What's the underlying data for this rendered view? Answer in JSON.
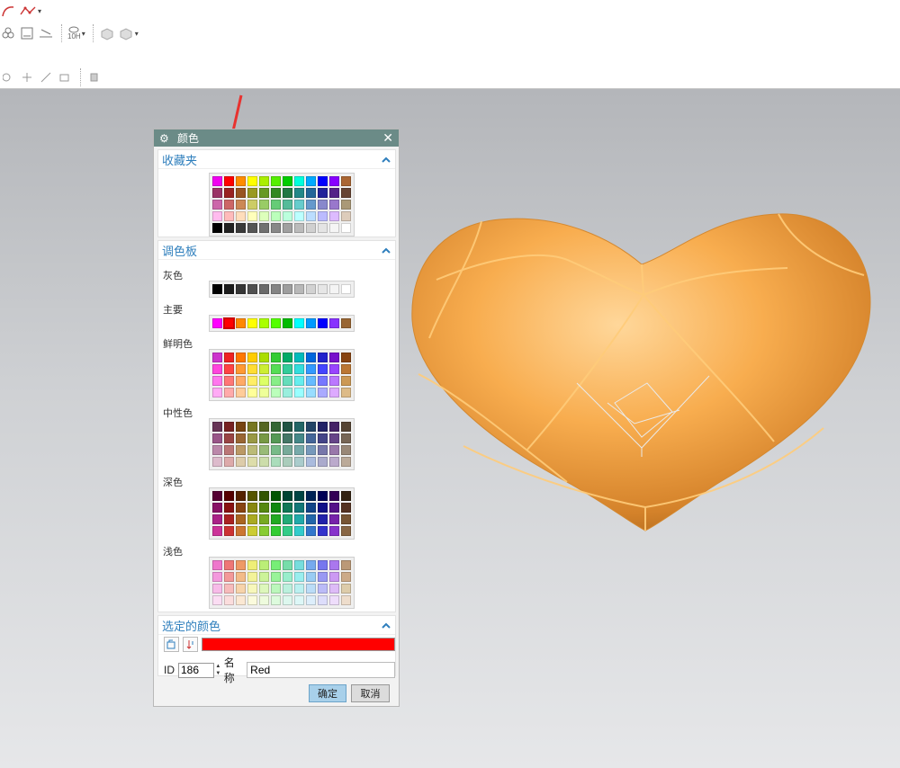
{
  "window": {
    "title": "颜色"
  },
  "toolbar": {
    "row1": [
      "curve-icon",
      "spline-icon"
    ],
    "row2": [
      "assembly-icon",
      "drawing-icon",
      "measure-icon",
      "view-10h-icon",
      "cube-icon",
      "cube-multi-icon"
    ],
    "row2_label": "10H",
    "row3": [
      "circle-icon",
      "plus-icon",
      "line-icon",
      "snap-icon",
      "layer-icon"
    ]
  },
  "sections": {
    "favorites": {
      "title": "收藏夹"
    },
    "palette": {
      "title": "调色板"
    },
    "selected": {
      "title": "选定的颜色"
    }
  },
  "groups": {
    "gray": "灰色",
    "main": "主要",
    "bright": "鲜明色",
    "neutral": "中性色",
    "dark": "深色",
    "light": "浅色"
  },
  "colors": {
    "favorites": [
      [
        "#f000f0",
        "#ff0000",
        "#ff8c00",
        "#ffff00",
        "#aaee00",
        "#55ee00",
        "#00cc00",
        "#00ffdd",
        "#00aaff",
        "#0000ff",
        "#8800ff",
        "#aa6633"
      ],
      [
        "#9a3366",
        "#992222",
        "#995522",
        "#999922",
        "#669922",
        "#338822",
        "#227744",
        "#228888",
        "#226699",
        "#222299",
        "#552288",
        "#664433"
      ],
      [
        "#cc66aa",
        "#cc6666",
        "#cc8855",
        "#cccc66",
        "#99cc66",
        "#66cc77",
        "#55bb99",
        "#66cccc",
        "#6699cc",
        "#8888cc",
        "#9977cc",
        "#aa9977"
      ],
      [
        "#ffbbee",
        "#ffbbbb",
        "#ffddbb",
        "#ffffbb",
        "#ddffbb",
        "#bbffbb",
        "#bbffdd",
        "#bbffff",
        "#bbddff",
        "#bbbbff",
        "#ddbbff",
        "#ddccbb"
      ],
      [
        "#000000",
        "#222222",
        "#3a3a3a",
        "#555555",
        "#707070",
        "#888888",
        "#a0a0a0",
        "#bbbbbb",
        "#d0d0d0",
        "#e4e4e4",
        "#f5f5f5",
        "#ffffff"
      ]
    ],
    "gray": [
      [
        "#000000",
        "#1c1c1c",
        "#363636",
        "#505050",
        "#6a6a6a",
        "#848484",
        "#9e9e9e",
        "#b8b8b8",
        "#d2d2d2",
        "#e6e6e6",
        "#f4f4f4",
        "#ffffff"
      ]
    ],
    "main": [
      [
        "#ff00ff",
        "#ff0000",
        "#ff8800",
        "#ffff00",
        "#aaff00",
        "#55ff00",
        "#00bb00",
        "#00ffff",
        "#0099ff",
        "#0000ff",
        "#8833ff",
        "#996633"
      ]
    ],
    "bright": [
      [
        "#cc33cc",
        "#ee2222",
        "#ff7700",
        "#ffcc00",
        "#aadd00",
        "#33cc33",
        "#00aa66",
        "#00bbbb",
        "#0066dd",
        "#2222cc",
        "#7711cc",
        "#884411"
      ],
      [
        "#ff44dd",
        "#ff4444",
        "#ff9933",
        "#ffdd33",
        "#ccee33",
        "#55dd55",
        "#33cc99",
        "#33dddd",
        "#3399ff",
        "#4444ff",
        "#9944ff",
        "#bb7733"
      ],
      [
        "#ff77ee",
        "#ff7777",
        "#ffaa66",
        "#ffee66",
        "#ddff66",
        "#88ee88",
        "#66ddbb",
        "#66eeee",
        "#66bbff",
        "#7777ff",
        "#bb77ff",
        "#cc9955"
      ],
      [
        "#ffaaf5",
        "#ffaaaa",
        "#ffcc99",
        "#ffff99",
        "#eeff99",
        "#bbffbb",
        "#99eedd",
        "#99ffff",
        "#99ddff",
        "#aaaaff",
        "#ddaaff",
        "#ddbb88"
      ]
    ],
    "neutral": [
      [
        "#663355",
        "#772222",
        "#774411",
        "#777722",
        "#556622",
        "#336633",
        "#225544",
        "#226666",
        "#224466",
        "#222266",
        "#442266",
        "#554433"
      ],
      [
        "#995588",
        "#994444",
        "#996633",
        "#999944",
        "#779944",
        "#559955",
        "#447766",
        "#448888",
        "#446699",
        "#444488",
        "#664488",
        "#776655"
      ],
      [
        "#bb88aa",
        "#bb7777",
        "#bb9966",
        "#bbbb77",
        "#99bb77",
        "#77bb88",
        "#77aa99",
        "#77aaaa",
        "#7799bb",
        "#7777aa",
        "#9977aa",
        "#998877"
      ],
      [
        "#ddbbcc",
        "#ddaaaa",
        "#ddccaa",
        "#ddddaa",
        "#ccddaa",
        "#aaddbb",
        "#aaccbb",
        "#aacccc",
        "#aabbdd",
        "#aaaacc",
        "#bbaacc",
        "#bbaa99"
      ]
    ],
    "dark": [
      [
        "#550033",
        "#550000",
        "#552200",
        "#555500",
        "#335500",
        "#005500",
        "#004433",
        "#004444",
        "#002255",
        "#000055",
        "#330055",
        "#332211"
      ],
      [
        "#881166",
        "#881111",
        "#884411",
        "#888811",
        "#558811",
        "#118811",
        "#117755",
        "#117777",
        "#114488",
        "#111188",
        "#551188",
        "#553322"
      ],
      [
        "#aa2288",
        "#aa2222",
        "#aa6622",
        "#aaaa22",
        "#77aa22",
        "#22aa22",
        "#22aa77",
        "#22aaaa",
        "#2266aa",
        "#2222aa",
        "#7722aa",
        "#775533"
      ],
      [
        "#cc3399",
        "#cc3333",
        "#cc7733",
        "#cccc33",
        "#88cc33",
        "#33cc33",
        "#33cc88",
        "#33cccc",
        "#3377cc",
        "#3333cc",
        "#8833cc",
        "#886644"
      ]
    ],
    "light": [
      [
        "#ee77cc",
        "#ee7777",
        "#ee9966",
        "#eeee77",
        "#bbee77",
        "#77ee77",
        "#77ddaa",
        "#77dddd",
        "#77aaee",
        "#7777ee",
        "#aa77ee",
        "#bb9977"
      ],
      [
        "#f399dd",
        "#f39999",
        "#f3bb88",
        "#f3f399",
        "#ccf399",
        "#99f399",
        "#99eecc",
        "#99eeee",
        "#99ccf3",
        "#9999f3",
        "#cc99f3",
        "#ccaa88"
      ],
      [
        "#f7bbe8",
        "#f7bbbb",
        "#f7d3aa",
        "#f7f7bb",
        "#ddf7bb",
        "#bbf7bb",
        "#bbf0dd",
        "#bbf0f0",
        "#bbdcf7",
        "#bbbbf7",
        "#ddbbf7",
        "#ddccaa"
      ],
      [
        "#fbddf3",
        "#fbdddd",
        "#fbe8d3",
        "#fbfbdd",
        "#eefbdd",
        "#ddfbdd",
        "#ddf7ee",
        "#ddf7f7",
        "#ddeefb",
        "#ddddfb",
        "#eeddfb",
        "#eeddcc"
      ]
    ]
  },
  "selected": {
    "color": "#ff0000",
    "id_label": "ID",
    "id_value": "186",
    "name_label": "名称",
    "name_value": "Red"
  },
  "buttons": {
    "ok": "确定",
    "cancel": "取消"
  },
  "accent": "#2f7fbd",
  "title_bar_color": "#6b8b87",
  "model_color": "#f6ab4e"
}
